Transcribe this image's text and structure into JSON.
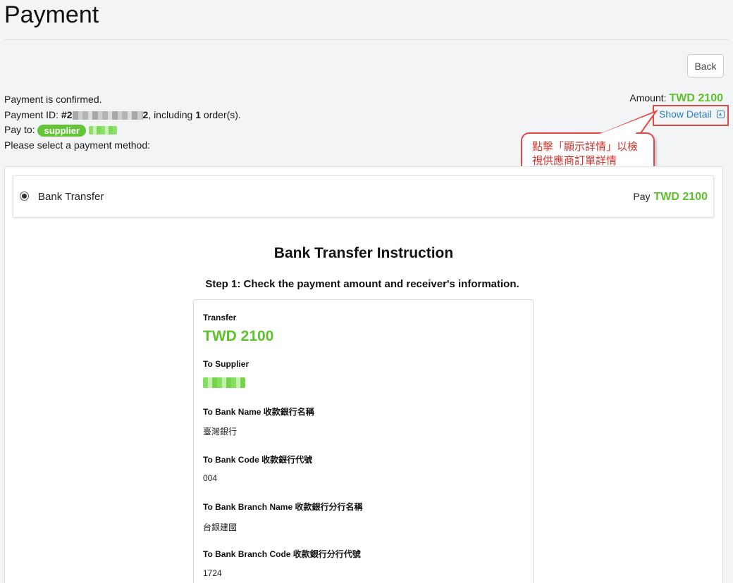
{
  "page": {
    "title": "Payment"
  },
  "toolbar": {
    "back_label": "Back"
  },
  "info": {
    "confirmed_text": "Payment is confirmed.",
    "payment_id_prefix": "Payment ID: ",
    "payment_id_start": "#2",
    "payment_id_end": "2",
    "including_text": ", including ",
    "order_count": "1",
    "order_suffix": " order(s).",
    "pay_to_label": "Pay to:",
    "supplier_badge": "supplier",
    "select_method_text": "Please select a payment method:"
  },
  "amount": {
    "label": "Amount:",
    "value": "TWD 2100"
  },
  "show_detail": {
    "label": "Show Detail"
  },
  "callout": {
    "line1": "點擊「顯示詳情」以檢",
    "line2": "視供應商訂單詳情"
  },
  "payment_option": {
    "label": "Bank Transfer",
    "pay_label": "Pay",
    "pay_value": "TWD 2100",
    "selected": true
  },
  "instruction": {
    "title": "Bank Transfer Instruction",
    "step1": "Step 1: Check the payment amount and receiver's information."
  },
  "transfer_details": {
    "transfer_label": "Transfer",
    "transfer_value": "TWD 2100",
    "supplier_label": "To Supplier",
    "bank_name_label": "To Bank Name 收款銀行名稱",
    "bank_name_value": "臺灣銀行",
    "bank_code_label": "To Bank Code 收款銀行代號",
    "bank_code_value": "004",
    "branch_name_label": "To Bank Branch Name 收款銀行分行名稱",
    "branch_name_value": "台銀建國",
    "branch_code_label": "To Bank Branch Code 收款銀行分行代號",
    "branch_code_value": "1724"
  },
  "colors": {
    "accent_green": "#5ec22c",
    "link_blue": "#2a7fc6",
    "callout_red": "#e04a45"
  }
}
